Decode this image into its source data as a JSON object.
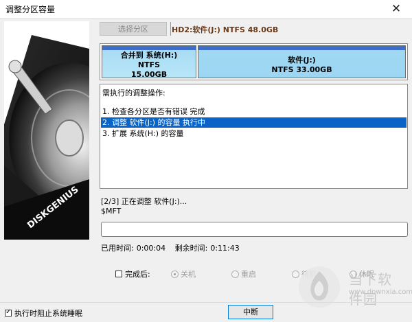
{
  "window": {
    "title": "调整分区容量",
    "close_glyph": "✕"
  },
  "disk_panel": {
    "brand": "DISKGENIUS"
  },
  "toolbar": {
    "select_partition_label": "选择分区",
    "disk_info": "HD2:软件(J:) NTFS 48.0GB"
  },
  "partitions": [
    {
      "label": "合并到 系统(H:)",
      "fs": "NTFS",
      "size": "15.00GB",
      "fraction": 0.3125
    },
    {
      "label": "软件(J:)",
      "fs": "NTFS",
      "size": "33.00GB",
      "fraction": 0.6875
    }
  ],
  "operations": {
    "title": "需执行的调整操作:",
    "items": [
      {
        "text": "1. 检查各分区是否有错误      完成",
        "highlighted": false
      },
      {
        "text": "2. 调整 软件(J:) 的容量      执行中",
        "highlighted": true
      },
      {
        "text": "3. 扩展 系统(H:) 的容量",
        "highlighted": false
      }
    ]
  },
  "status": {
    "line1": "[2/3] 正在调整 软件(J:)...",
    "line2": "$MFT",
    "progress": 0
  },
  "timing": {
    "elapsed_label": "已用时间:",
    "elapsed": "0:00:04",
    "remaining_label": "剩余时间:",
    "remaining": "0:11:43"
  },
  "after_complete": {
    "label": "完成后:",
    "checked": false,
    "options": [
      {
        "label": "关机",
        "selected": true
      },
      {
        "label": "重启",
        "selected": false
      },
      {
        "label": "待机",
        "selected": false
      },
      {
        "label": "休眠",
        "selected": false
      }
    ]
  },
  "footer": {
    "prevent_sleep_label": "执行时阻止系统睡眠",
    "prevent_sleep_checked": true,
    "stop_label": "中断"
  },
  "watermark": {
    "text": "当下软件园",
    "url": "www.downxia.com"
  },
  "colors": {
    "highlight": "#0a64c8",
    "partition_fill": "#a8dcf4",
    "partition_top": "#3b6fc9"
  }
}
